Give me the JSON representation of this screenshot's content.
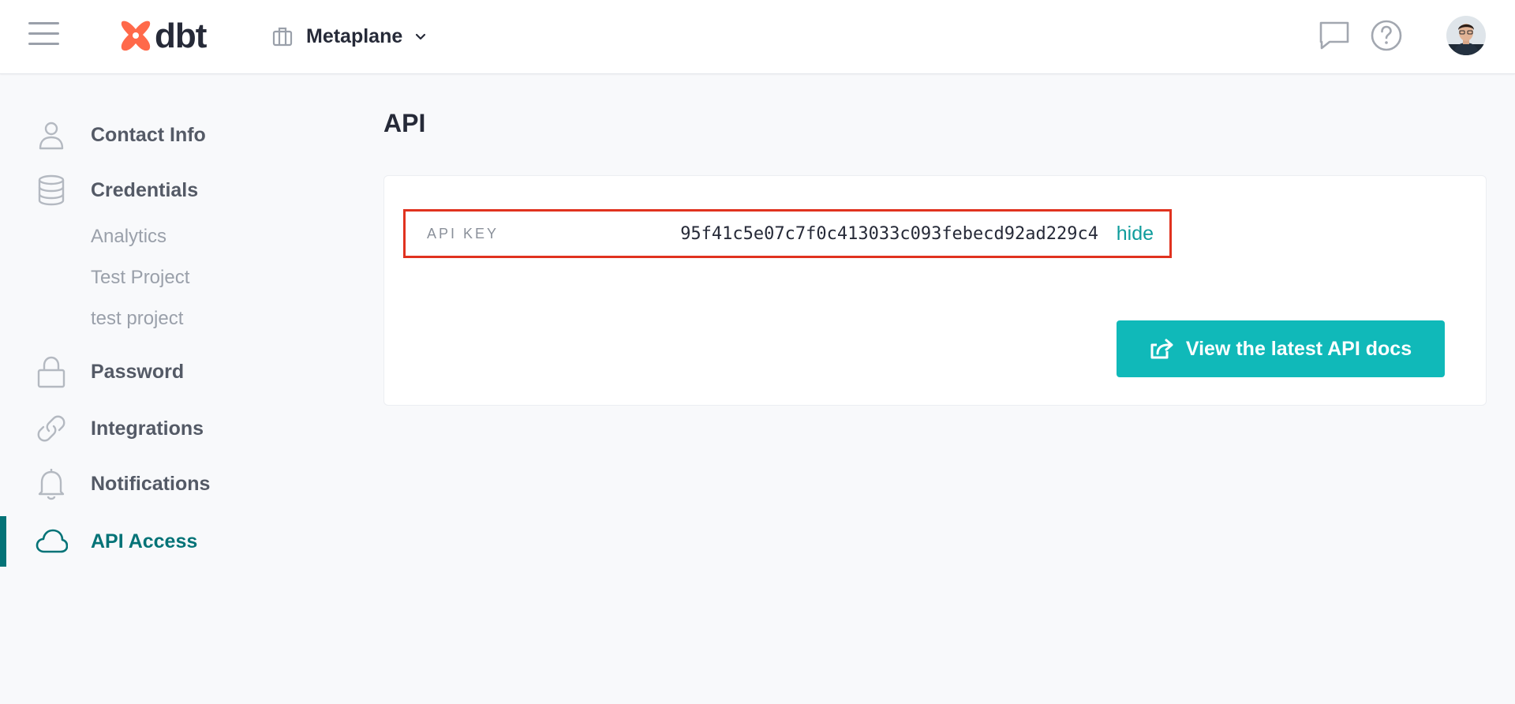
{
  "header": {
    "app_name": "dbt",
    "account_name": "Metaplane",
    "icons": [
      "hamburger-menu-icon",
      "dbt-logo-icon",
      "briefcase-icon",
      "chevron-down-icon",
      "chat-icon",
      "help-icon",
      "user-avatar"
    ]
  },
  "sidebar": {
    "items": [
      {
        "label": "Contact Info",
        "icon": "user-icon"
      },
      {
        "label": "Credentials",
        "icon": "database-icon"
      },
      {
        "label": "Password",
        "icon": "lock-icon"
      },
      {
        "label": "Integrations",
        "icon": "link-icon"
      },
      {
        "label": "Notifications",
        "icon": "bell-icon"
      },
      {
        "label": "API Access",
        "icon": "cloud-icon",
        "active": true
      }
    ],
    "credentials_sub": [
      "Analytics",
      "Test Project",
      "test project"
    ]
  },
  "main": {
    "title": "API",
    "api_key_label": "API KEY",
    "api_key_value": "95f41c5e07c7f0c413033c093febecd92ad229c4",
    "hide_label": "hide",
    "docs_button_label": "View the latest API docs"
  },
  "colors": {
    "brand_teal": "#047377",
    "button_teal": "#10b9b9",
    "link_teal": "#0f9c9c",
    "highlight_red": "#e0321f",
    "dbt_orange": "#ff694a"
  }
}
